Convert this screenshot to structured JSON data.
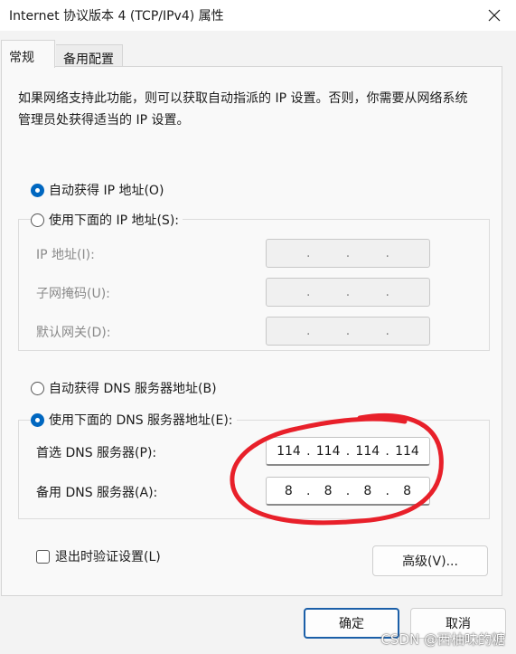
{
  "window": {
    "title": "Internet 协议版本 4 (TCP/IPv4) 属性"
  },
  "tabs": [
    {
      "label": "常规",
      "active": true
    },
    {
      "label": "备用配置",
      "active": false
    }
  ],
  "intro_text": "如果网络支持此功能，则可以获取自动指派的 IP 设置。否则，你需要从网络系统管理员处获得适当的 IP 设置。",
  "ip_section": {
    "auto_label": "自动获得 IP 地址(O)",
    "manual_label": "使用下面的 IP 地址(S):",
    "selected": "auto",
    "fields": [
      {
        "label": "IP 地址(I):",
        "octets": [
          "",
          "",
          "",
          ""
        ]
      },
      {
        "label": "子网掩码(U):",
        "octets": [
          "",
          "",
          "",
          ""
        ]
      },
      {
        "label": "默认网关(D):",
        "octets": [
          "",
          "",
          "",
          ""
        ]
      }
    ]
  },
  "dns_section": {
    "auto_label": "自动获得 DNS 服务器地址(B)",
    "manual_label": "使用下面的 DNS 服务器地址(E):",
    "selected": "manual",
    "preferred": {
      "label": "首选 DNS 服务器(P):",
      "octets": [
        "114",
        "114",
        "114",
        "114"
      ]
    },
    "alternate": {
      "label": "备用 DNS 服务器(A):",
      "octets": [
        "8",
        "8",
        "8",
        "8"
      ]
    }
  },
  "validate_label": "退出时验证设置(L)",
  "validate_checked": false,
  "advanced_label": "高级(V)...",
  "ok_label": "确定",
  "cancel_label": "取消",
  "watermark": "CSDN @西柚味的糖",
  "colors": {
    "accent": "#0067c0",
    "annotation": "#e8202a"
  }
}
